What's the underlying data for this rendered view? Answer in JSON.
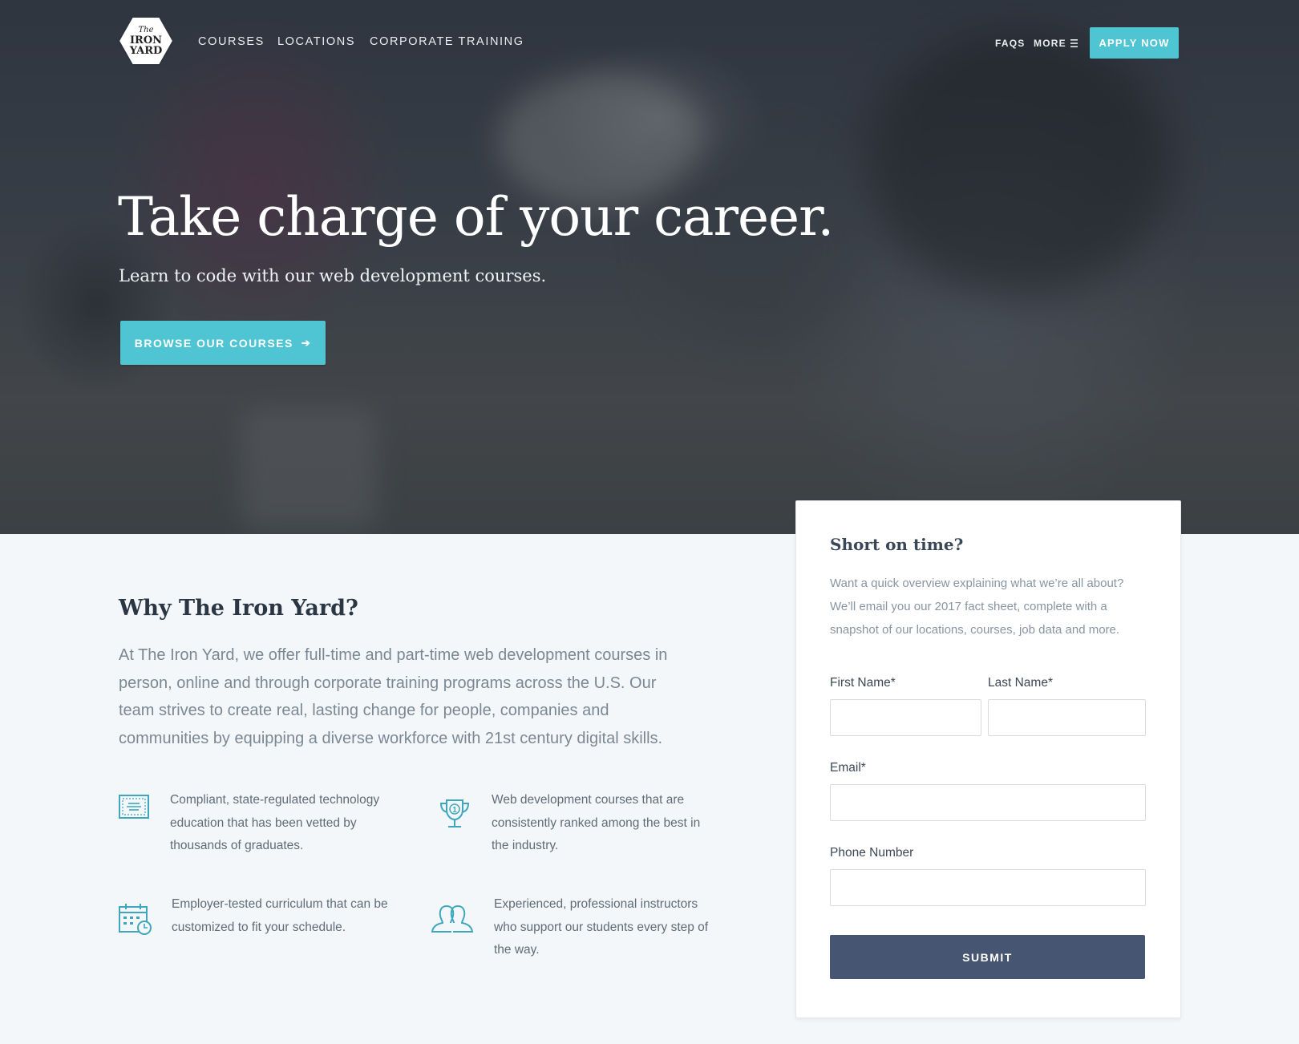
{
  "nav": {
    "logo_label": "The Iron Yard",
    "links": [
      "Courses",
      "Locations",
      "Corporate Training"
    ],
    "faqs": "FAQS",
    "more": "MORE",
    "apply": "APPLY NOW"
  },
  "hero": {
    "headline": "Take charge of your career.",
    "subhead": "Learn to code with our web development courses.",
    "cta": "BROWSE OUR COURSES"
  },
  "why": {
    "title": "Why The Iron Yard?",
    "text": "At The Iron Yard, we offer full-time and part-time web development courses in person, online and through corporate training programs across the U.S. Our team strives to create real, lasting change for people, companies and communities by equipping a diverse workforce with 21st century digital skills.",
    "features": [
      {
        "icon": "certificate-icon",
        "text": "Compliant, state-regulated technology education that has been vetted by thousands of graduates."
      },
      {
        "icon": "trophy-icon",
        "text": "Web development courses that are consistently ranked among the best in the industry."
      },
      {
        "icon": "calendar-clock-icon",
        "text": "Employer-tested curriculum that can be customized to fit your schedule."
      },
      {
        "icon": "people-icon",
        "text": "Experienced, professional instructors who support our students every step of the way."
      }
    ]
  },
  "form": {
    "title": "Short on time?",
    "description": "Want a quick overview explaining what we’re all about? We’ll email you our 2017 fact sheet, complete with a snapshot of our locations, courses, job data and more.",
    "first_name_label": "First Name*",
    "last_name_label": "Last Name*",
    "email_label": "Email*",
    "phone_label": "Phone Number",
    "first_name_value": "",
    "last_name_value": "",
    "email_value": "",
    "phone_value": "",
    "submit": "SUBMIT"
  },
  "colors": {
    "accent": "#4fc5d3",
    "submit": "#465571",
    "icon": "#3fa6bd"
  }
}
